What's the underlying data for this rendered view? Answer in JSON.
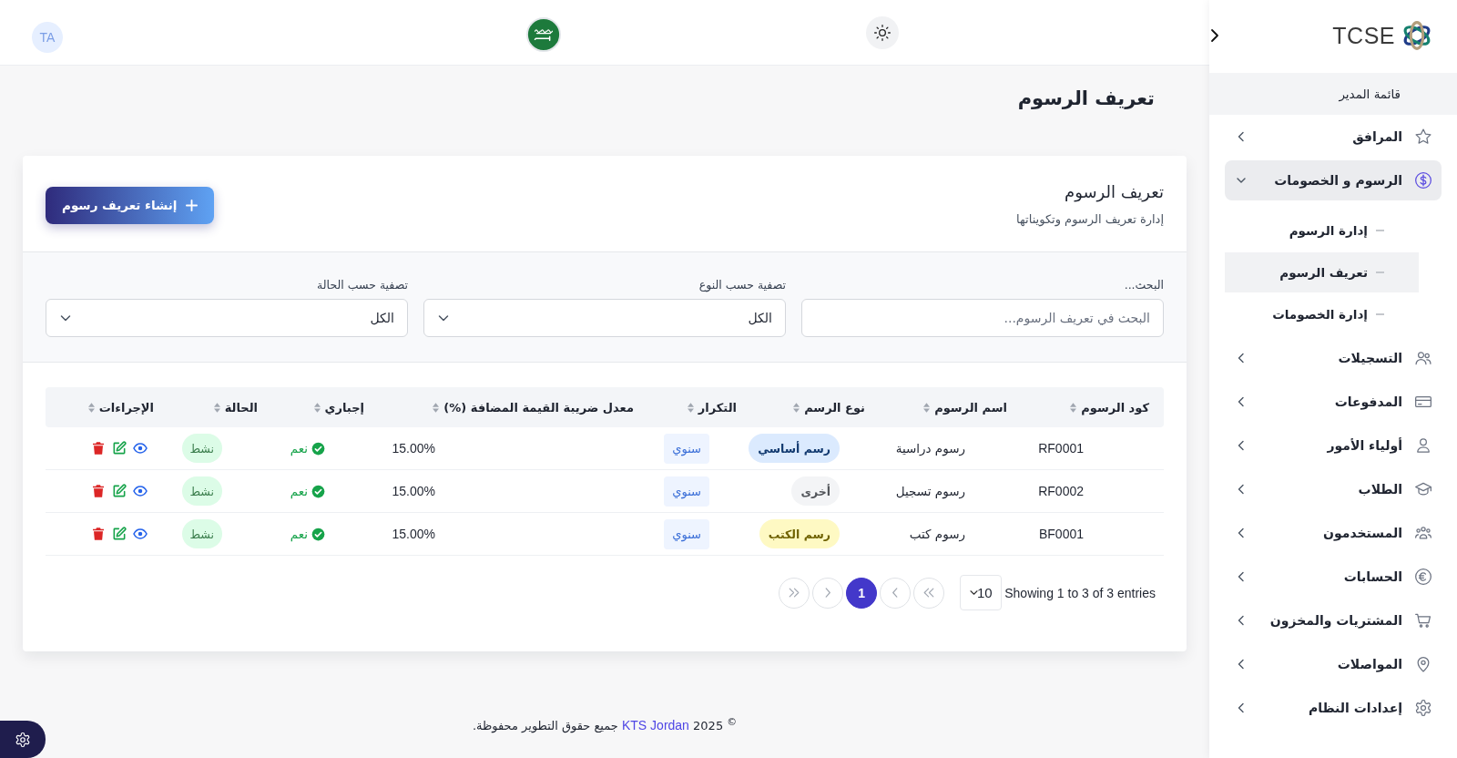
{
  "topbar": {
    "avatar": "TA"
  },
  "sidebar": {
    "brand": "TCSE",
    "section": "قائمة المدير",
    "items": [
      {
        "label": "المرافق",
        "selected": false,
        "expanded": false
      },
      {
        "label": "الرسوم و الخصومات",
        "selected": true,
        "expanded": true,
        "children": [
          {
            "label": "إدارة الرسوم",
            "selected": false
          },
          {
            "label": "تعريف الرسوم",
            "selected": true
          },
          {
            "label": "إدارة الخصومات",
            "selected": false
          }
        ]
      },
      {
        "label": "التسجيلات",
        "selected": false,
        "expanded": false
      },
      {
        "label": "المدفوعات",
        "selected": false,
        "expanded": false
      },
      {
        "label": "أولياء الأمور",
        "selected": false,
        "expanded": false
      },
      {
        "label": "الطلاب",
        "selected": false,
        "expanded": false
      },
      {
        "label": "المستخدمون",
        "selected": false,
        "expanded": false
      },
      {
        "label": "الحسابات",
        "selected": false,
        "expanded": false
      },
      {
        "label": "المشتريات والمخزون",
        "selected": false,
        "expanded": false
      },
      {
        "label": "المواصلات",
        "selected": false,
        "expanded": false
      },
      {
        "label": "إعدادات النظام",
        "selected": false,
        "expanded": false
      }
    ]
  },
  "page": {
    "title": "تعريف الرسوم"
  },
  "card": {
    "title": "تعريف الرسوم",
    "subtitle": "إدارة تعريف الرسوم وتكويناتها",
    "create_button": "إنشاء تعريف رسوم"
  },
  "filters": [
    {
      "kind": "search",
      "label": "البحث...",
      "placeholder": "البحث في تعريف الرسوم..."
    },
    {
      "kind": "select",
      "label": "تصفية حسب النوع",
      "value": "الكل"
    },
    {
      "kind": "select",
      "label": "تصفية حسب الحالة",
      "value": "الكل"
    }
  ],
  "table": {
    "columns": [
      "كود الرسوم",
      "اسم الرسوم",
      "نوع الرسم",
      "التكرار",
      "معدل ضريبة القيمة المضافة (%)",
      "إجباري",
      "الحالة",
      "الإجراءات"
    ],
    "rows": [
      {
        "code": "RF0001",
        "name": "رسوم دراسية",
        "type": {
          "label": "رسم أساسي",
          "color": "#dbeafe"
        },
        "frequency": "سنوي",
        "vat_rate": "15.00%",
        "mandatory": {
          "label": "نعم",
          "checked": true
        },
        "status": {
          "label": "نشط",
          "active": true
        }
      },
      {
        "code": "RF0002",
        "name": "رسوم تسجيل",
        "type": {
          "label": "أخرى",
          "color": "#f3f4f6"
        },
        "frequency": "سنوي",
        "vat_rate": "15.00%",
        "mandatory": {
          "label": "نعم",
          "checked": true
        },
        "status": {
          "label": "نشط",
          "active": true
        }
      },
      {
        "code": "BF0001",
        "name": "رسوم كتب",
        "type": {
          "label": "رسم الكتب",
          "color": "#fef9c3"
        },
        "frequency": "سنوي",
        "vat_rate": "15.00%",
        "mandatory": {
          "label": "نعم",
          "checked": true
        },
        "status": {
          "label": "نشط",
          "active": true
        }
      }
    ]
  },
  "pagination": {
    "summary": "Showing 1 to 3 of 3 entries",
    "page_size": "10",
    "pages": [
      {
        "label": "1",
        "selected": true
      }
    ]
  },
  "footer": {
    "prefix": "$^{©}$ 2025",
    "link": "KTS Jordan",
    "suffix": "جميع حقوق التطوير محفوظة."
  }
}
